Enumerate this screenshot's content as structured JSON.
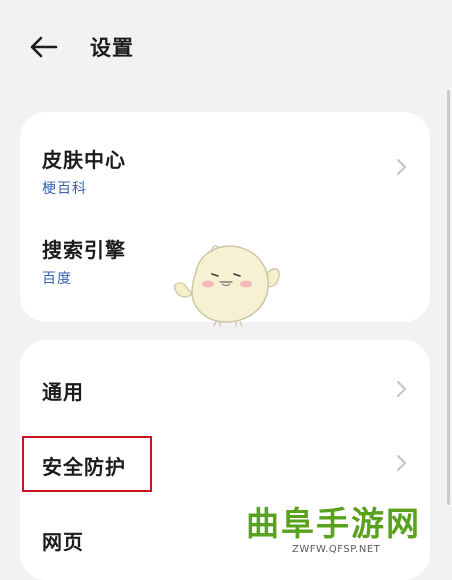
{
  "header": {
    "back_icon": "arrow-left-icon",
    "title": "设置"
  },
  "group1": {
    "items": [
      {
        "label": "皮肤中心",
        "subtitle": "梗百科",
        "icon": "chevron-right-icon"
      },
      {
        "label": "搜索引擎",
        "subtitle": "百度"
      }
    ]
  },
  "group2": {
    "items": [
      {
        "label": "通用",
        "icon": "chevron-right-icon"
      },
      {
        "label": "安全防护",
        "icon": "chevron-right-icon",
        "highlighted": true
      },
      {
        "label": "网页"
      }
    ]
  },
  "overlay": {
    "mascot": "chick-mascot-icon"
  },
  "watermark": {
    "logo_text": "曲阜手游网",
    "url": "ZWFW.QFSP.NET"
  },
  "colors": {
    "background": "#f2f2f4",
    "card": "#ffffff",
    "subtitle": "#3a63b6",
    "highlight_border": "#c8161e",
    "watermark": "#5aa21e"
  }
}
